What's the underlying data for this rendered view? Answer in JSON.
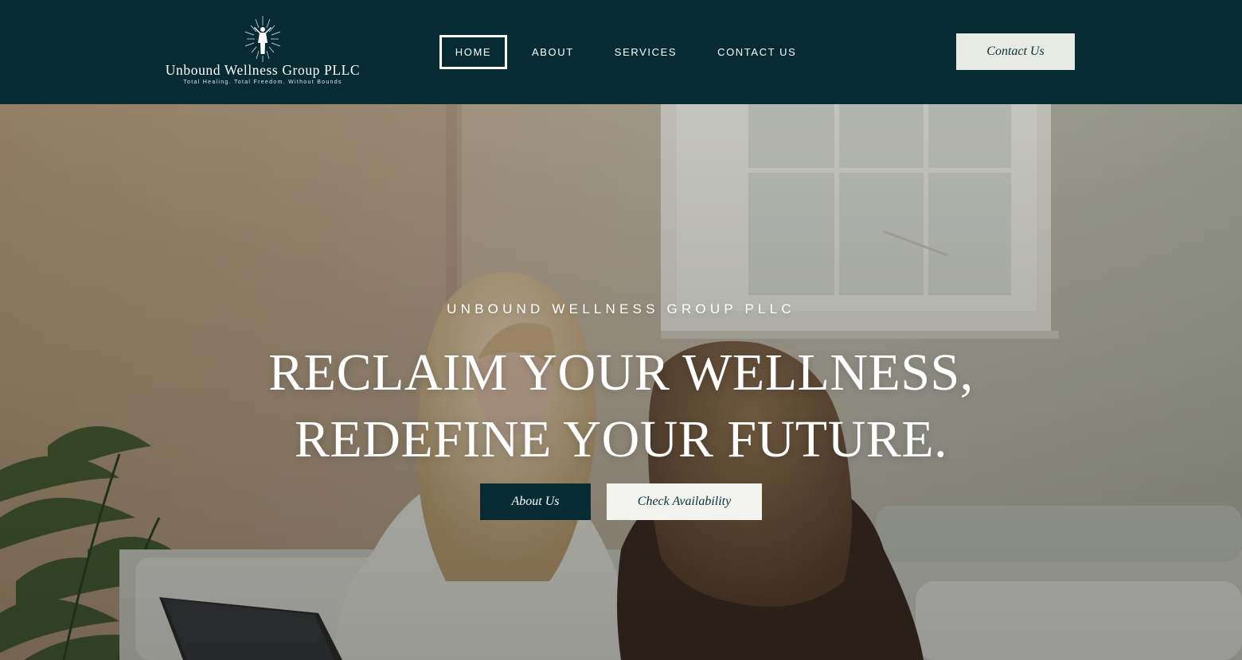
{
  "header": {
    "logo": {
      "name": "Unbound Wellness Group PLLC",
      "tagline": "Total Healing. Total Freedom. Without Bounds",
      "icon": "radiant-figure-icon"
    },
    "nav": [
      {
        "label": "HOME",
        "active": true
      },
      {
        "label": "ABOUT",
        "active": false
      },
      {
        "label": "SERVICES",
        "active": false
      },
      {
        "label": "CONTACT US",
        "active": false
      }
    ],
    "cta_label": "Contact Us"
  },
  "hero": {
    "eyebrow": "UNBOUND WELLNESS GROUP PLLC",
    "title_line1": "RECLAIM YOUR WELLNESS,",
    "title_line2": "REDEFINE YOUR FUTURE.",
    "primary_button": "About Us",
    "secondary_button": "Check Availability"
  },
  "colors": {
    "brand_dark": "#062b33",
    "light_button": "#e7ebe4",
    "text_light": "#ffffff"
  }
}
